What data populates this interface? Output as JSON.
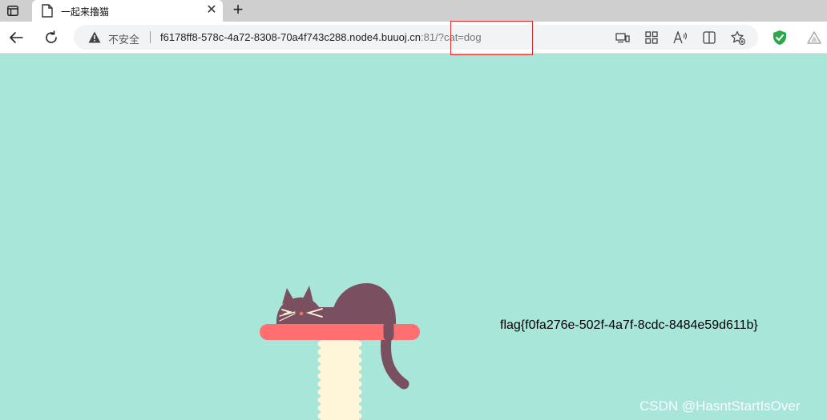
{
  "browser": {
    "tab": {
      "title": "一起来撸猫"
    },
    "address": {
      "security_label": "不安全",
      "url_host": "f6178ff8-578c-4a72-8308-70a4f743c288.node4.buuoj.cn",
      "url_rest": ":81/?cat=dog"
    },
    "icons": {
      "tab_actions": "tab-actions-icon",
      "page": "page-icon",
      "close": "close-icon",
      "new_tab": "plus-icon",
      "back": "back-arrow-icon",
      "refresh": "refresh-icon",
      "warning": "warning-icon",
      "cast": "cast-icon",
      "apps": "apps-icon",
      "read_aloud": "read-aloud-icon",
      "split": "split-screen-icon",
      "favorite": "add-favorite-icon",
      "shield": "shield-icon",
      "profile": "profile-icon"
    }
  },
  "page": {
    "background": "#a8e6da",
    "flag": "flag{f0fa276e-502f-4a7f-8cdc-8484e59d611b}",
    "watermark": "CSDN @HasntStartIsOver"
  },
  "annotation": {
    "color": "#d92b2b"
  }
}
